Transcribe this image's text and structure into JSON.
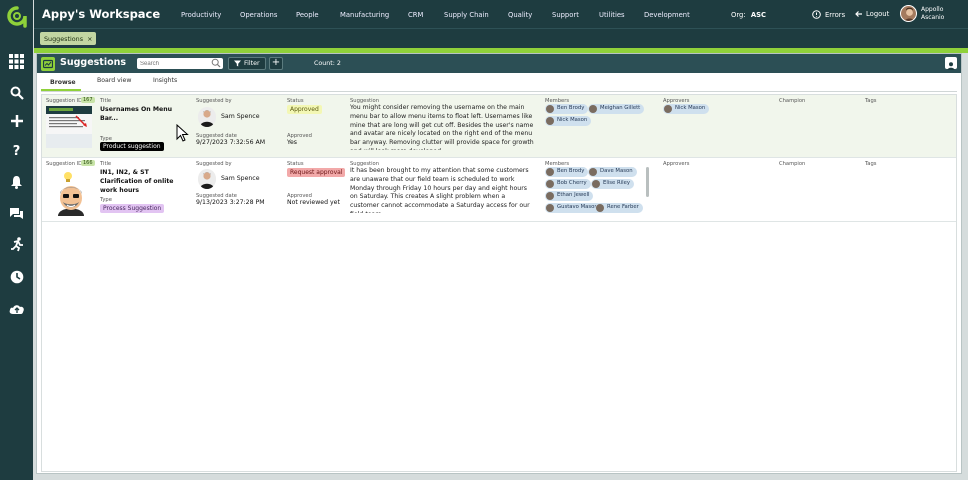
{
  "header": {
    "workspace_title": "Appy's Workspace",
    "nav": [
      "Productivity",
      "Operations",
      "People",
      "Manufacturing",
      "CRM",
      "Supply Chain",
      "Quality",
      "Support",
      "Utilities",
      "Development"
    ],
    "org_label": "Org:",
    "org_value": "ASC",
    "errors_label": "Errors",
    "logout_label": "Logout",
    "user_first": "Appollo",
    "user_last": "Ascanio"
  },
  "chips": [
    {
      "label": "Suggestions",
      "close": "×"
    }
  ],
  "panel": {
    "title": "Suggestions",
    "search_placeholder": "Search",
    "filter_label": "Filter",
    "add_label": "+",
    "count_label": "Count: 2"
  },
  "tabs": [
    "Browse",
    "Board view",
    "Insights"
  ],
  "labels": {
    "suggestion_id": "Suggestion ID",
    "title": "Title",
    "type": "Type",
    "suggested_by": "Suggested by",
    "suggested_date": "Suggested date",
    "status": "Status",
    "approved": "Approved",
    "suggestion": "Suggestion",
    "members": "Members",
    "approvers": "Approvers",
    "champion": "Champion",
    "tags": "Tags"
  },
  "rows": [
    {
      "id": "167",
      "title": "Usernames On Menu Bar...",
      "type": "Product suggestion",
      "suggested_by": "Sam Spence",
      "suggested_date": "9/27/2023 7:32:56 AM",
      "status": "Approved",
      "approved": "Yes",
      "suggestion": "You might consider removing the username on the main menu bar to allow menu items to float left.  Usernames like mine that are long will get cut off.  Besides the user's name and avatar are nicely located on the right end of the menu bar anyway.  Removing clutter will provide space for growth and will look more developed",
      "members": [
        "Ben Brody",
        "Meighan Gillett",
        "Nick Mason"
      ],
      "approvers": [
        "Nick Mason"
      ],
      "thumb_caption": "You might consider remo this allow menu item floa that are long will get"
    },
    {
      "id": "166",
      "title": "IN1, IN2, & ST Clarification of onlite work hours",
      "type": "Process Suggestion",
      "suggested_by": "Sam Spence",
      "suggested_date": "9/13/2023 3:27:28 PM",
      "status": "Request approval",
      "approved": "Not reviewed yet",
      "suggestion": "It has been brought to my attention that some customers are unaware that our field team is scheduled to work Monday through Friday 10 hours per day and eight hours on Saturday. This creates A slight problem when a customer cannot accommodate a Saturday access for our field team.",
      "members": [
        "Ben Brody",
        "Dave Mason",
        "Bob Cherry",
        "Elise Riley",
        "Ethan Jewell",
        "Gustavo Mason",
        "Rene Farber"
      ],
      "approvers": []
    }
  ],
  "colors": {
    "dark": "#1e3c40",
    "accent": "#8fd13a",
    "approved": "#f3f7b4",
    "request": "#f2a9a9",
    "product_pill": "#000000",
    "process_pill": "#e2c4f2"
  }
}
